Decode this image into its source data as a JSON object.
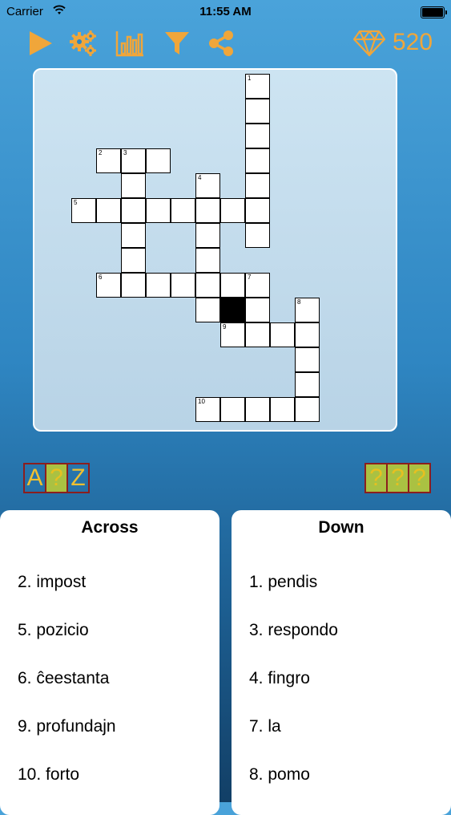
{
  "status_bar": {
    "carrier": "Carrier",
    "time": "11:55 AM"
  },
  "toolbar": {
    "icons": [
      "play-icon",
      "gears-icon",
      "stats-icon",
      "filter-icon",
      "share-icon"
    ],
    "gems": "520",
    "accent": "#f0a63a"
  },
  "board": {
    "numbers": [
      "1",
      "2",
      "3",
      "4",
      "5",
      "6",
      "7",
      "8",
      "9",
      "10"
    ]
  },
  "hints": {
    "a_to_z": {
      "left": "A",
      "middle": "?",
      "right": "Z"
    },
    "reveal": {
      "left": "?",
      "middle": "?",
      "right": "?"
    }
  },
  "across": {
    "title": "Across",
    "clues": [
      "2. impost",
      "5. pozicio",
      "6. ĉeestanta",
      "9. profundajn",
      "10. forto"
    ]
  },
  "down": {
    "title": "Down",
    "clues": [
      "1. pendis",
      "3. respondo",
      "4. fingro",
      "7. la",
      "8. pomo"
    ]
  }
}
